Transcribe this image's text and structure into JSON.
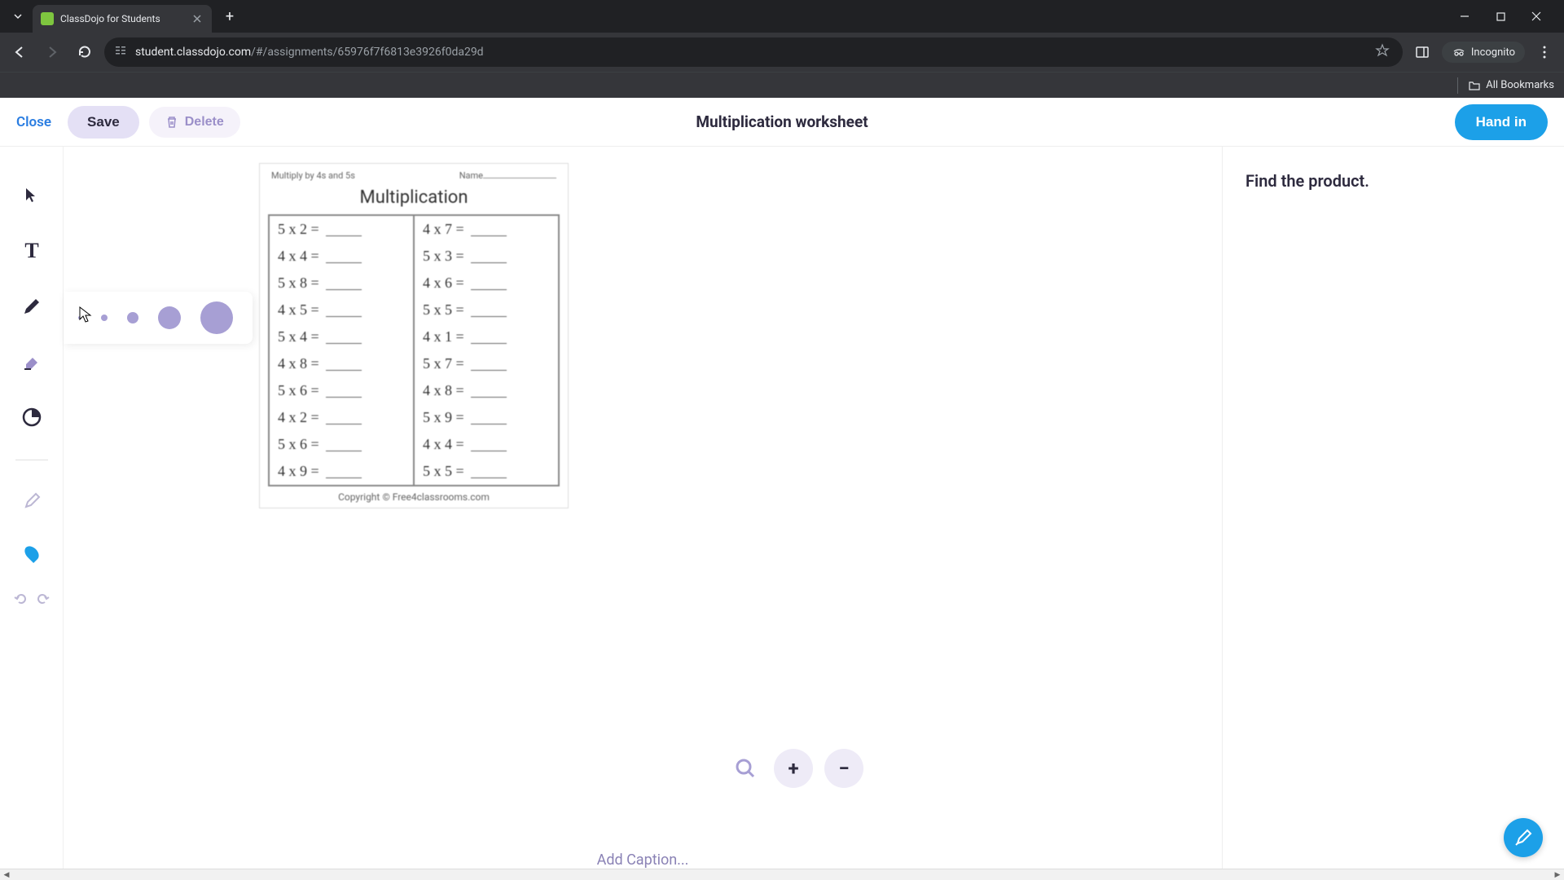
{
  "browser": {
    "tab_title": "ClassDojo for Students",
    "url_host": "student.classdojo.com",
    "url_path": "/#/assignments/65976f7f6813e3926f0da29d",
    "incognito_label": "Incognito",
    "all_bookmarks_label": "All Bookmarks"
  },
  "header": {
    "close": "Close",
    "save": "Save",
    "delete": "Delete",
    "title": "Multiplication worksheet",
    "hand_in": "Hand in"
  },
  "caption_placeholder": "Add Caption...",
  "right_panel": {
    "instruction": "Find the product."
  },
  "worksheet": {
    "header_left": "Multiply by 4s and 5s",
    "header_right_label": "Name",
    "title": "Multiplication",
    "footer": "Copyright © Free4classrooms.com",
    "left_col": [
      "5 x 2  =",
      "4 x 4  =",
      "5 x 8  =",
      "4 x 5  =",
      "5 x 4  =",
      "4 x 8  =",
      "5 x 6  =",
      "4 x 2  =",
      "5 x 6  =",
      "4 x 9  ="
    ],
    "right_col": [
      "4 x 7  =",
      "5 x 3  =",
      "4 x 6  =",
      "5 x 5  =",
      "4 x 1  =",
      "5 x 7  =",
      "4 x 8  =",
      "5 x 9  =",
      "4 x 4  =",
      "5 x 5  ="
    ]
  }
}
